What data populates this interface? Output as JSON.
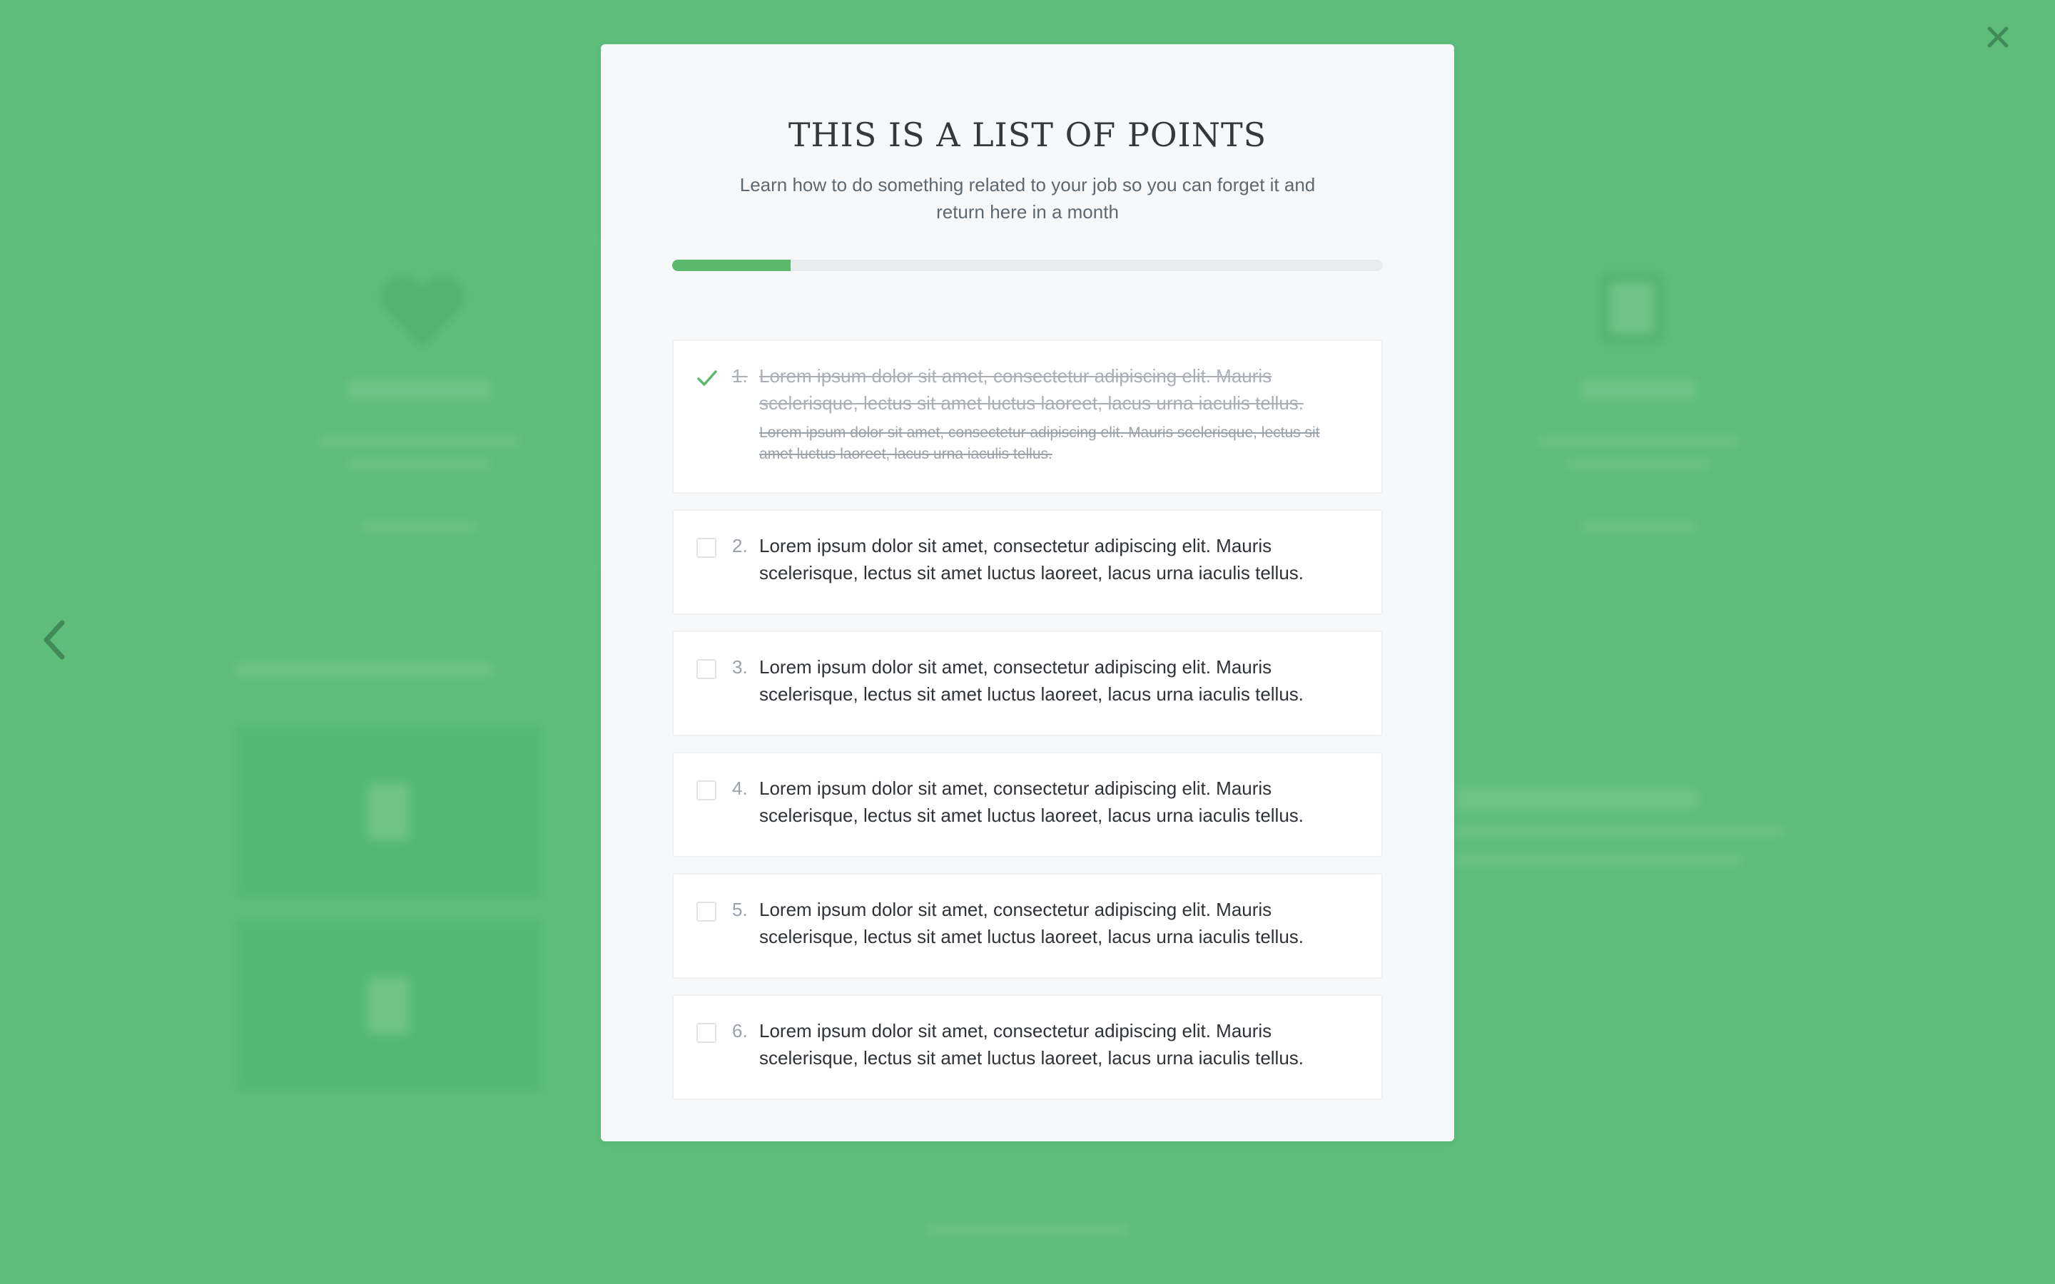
{
  "modal": {
    "title": "THIS IS A LIST OF POINTS",
    "subtitle": "Learn how to do something related to your job so you can forget it and return here in a month",
    "progress": 0.167
  },
  "points": [
    {
      "number": "1.",
      "text": "Lorem ipsum dolor sit amet, consectetur adipiscing elit. Mauris scelerisque, lectus sit amet luctus laoreet, lacus urna iaculis tellus.",
      "detail": "Lorem ipsum dolor sit amet, consectetur adipiscing elit. Mauris scelerisque, lectus sit amet luctus laoreet, lacus urna iaculis tellus.",
      "completed": true
    },
    {
      "number": "2.",
      "text": "Lorem ipsum dolor sit amet, consectetur adipiscing elit. Mauris scelerisque, lectus sit amet luctus laoreet, lacus urna iaculis tellus.",
      "completed": false
    },
    {
      "number": "3.",
      "text": "Lorem ipsum dolor sit amet, consectetur adipiscing elit. Mauris scelerisque, lectus sit amet luctus laoreet, lacus urna iaculis tellus.",
      "completed": false
    },
    {
      "number": "4.",
      "text": "Lorem ipsum dolor sit amet, consectetur adipiscing elit. Mauris scelerisque, lectus sit amet luctus laoreet, lacus urna iaculis tellus.",
      "completed": false
    },
    {
      "number": "5.",
      "text": "Lorem ipsum dolor sit amet, consectetur adipiscing elit. Mauris scelerisque, lectus sit amet luctus laoreet, lacus urna iaculis tellus.",
      "completed": false
    },
    {
      "number": "6.",
      "text": "Lorem ipsum dolor sit amet, consectetur adipiscing elit. Mauris scelerisque, lectus sit amet luctus laoreet, lacus urna iaculis tellus.",
      "completed": false
    }
  ],
  "icons": {
    "close": "close-icon",
    "previous": "chevron-left-icon",
    "completed": "checkmark-icon",
    "pending": "checkbox-icon"
  },
  "colors": {
    "background": "#5fbe7c",
    "accent": "#5cb86c",
    "modal": "#f7f8fa",
    "control": "#3f8a57"
  }
}
